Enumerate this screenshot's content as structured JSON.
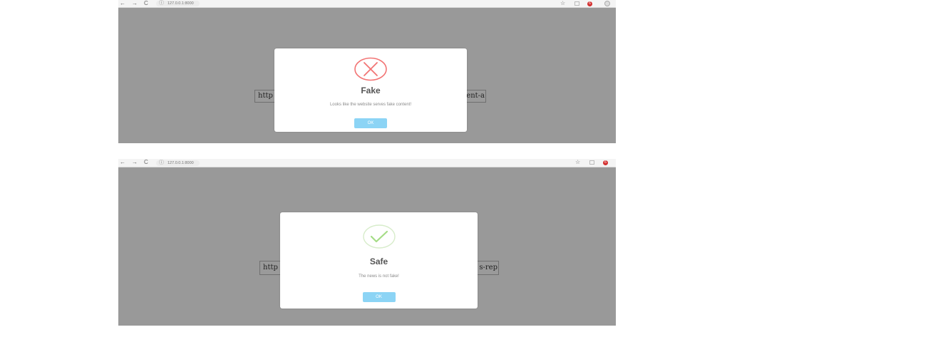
{
  "screenshots": [
    {
      "browser": {
        "nav_icons": {
          "back": "←",
          "forward": "→",
          "reload": "C"
        },
        "address": "127.0.0.1:8000",
        "address_icon": "ⓘ",
        "toolbar_icons": {
          "star": "☆"
        },
        "ext_badge": "6"
      },
      "url_field": {
        "left_text": "http",
        "right_text": "ent-a"
      },
      "modal": {
        "icon": "error-x-icon",
        "title": "Fake",
        "message": "Looks like the website serves fake content!",
        "ok_label": "OK"
      }
    },
    {
      "browser": {
        "nav_icons": {
          "back": "←",
          "forward": "→",
          "reload": "C"
        },
        "address": "127.0.0.1:8000",
        "address_icon": "ⓘ",
        "toolbar_icons": {
          "star": "☆"
        },
        "ext_badge": "6"
      },
      "url_field": {
        "left_text": "http",
        "right_text": "s-rep"
      },
      "modal": {
        "icon": "success-check-icon",
        "title": "Safe",
        "message": "The news is not fake!",
        "ok_label": "OK"
      }
    }
  ],
  "colors": {
    "overlay": "#999999",
    "error": "#f27474",
    "success": "#a5dc86",
    "button": "#8cd4f5"
  }
}
